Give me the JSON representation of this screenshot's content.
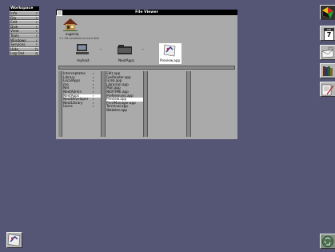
{
  "workspace_menu": {
    "title": "Workspace",
    "items": [
      {
        "label": "Info",
        "key": "r"
      },
      {
        "label": "File",
        "key": "r"
      },
      {
        "label": "Edit",
        "key": "r"
      },
      {
        "label": "Disk",
        "key": "r"
      },
      {
        "label": "View",
        "key": "r"
      },
      {
        "label": "Tools",
        "key": "r"
      },
      {
        "label": "Windows",
        "key": "r"
      },
      {
        "label": "Services",
        "key": "r"
      },
      {
        "label": "Hide",
        "key": "h"
      },
      {
        "label": "Log Out",
        "key": "q"
      }
    ]
  },
  "file_viewer": {
    "title": "File Viewer",
    "user": "eugeniq",
    "disk_info": "1.2 GB available on hard disk",
    "shelf": [
      {
        "label": "myhost",
        "icon": "computer-icon"
      },
      {
        "label": "NextApps",
        "icon": "folder-icon"
      },
      {
        "label": "Preview.app",
        "icon": "preview-app-icon"
      }
    ],
    "columns": [
      {
        "entries": [
          {
            "label": "Interceptates",
            "arrow": "r"
          },
          {
            "label": "Library",
            "arrow": "r"
          },
          {
            "label": "LocalApps",
            "arrow": "r"
          },
          {
            "label": "me",
            "arrow": "r"
          },
          {
            "label": "Net",
            "arrow": "r"
          },
          {
            "label": "NextAdmin",
            "arrow": "r"
          },
          {
            "label": "NextApps",
            "arrow": "r",
            "selected": true
          },
          {
            "label": "NextDeveloper",
            "arrow": "r"
          },
          {
            "label": "NextLibrary",
            "arrow": "r"
          },
          {
            "label": "Users",
            "arrow": "r"
          }
        ]
      },
      {
        "entries": [
          {
            "label": "Edit.app"
          },
          {
            "label": "FaxReader.app"
          },
          {
            "label": "Grab.app"
          },
          {
            "label": "Librarian.app"
          },
          {
            "label": "Mail.app"
          },
          {
            "label": "NEXTIME.app"
          },
          {
            "label": "Preferences.app"
          },
          {
            "label": "Preview.app",
            "selected": true
          },
          {
            "label": "PrintManager.app"
          },
          {
            "label": "Terminal.app"
          },
          {
            "label": "Webster.app"
          }
        ]
      },
      {
        "entries": []
      },
      {
        "entries": []
      }
    ]
  },
  "dock": {
    "calendar_month": "APR",
    "calendar_day": "7"
  }
}
